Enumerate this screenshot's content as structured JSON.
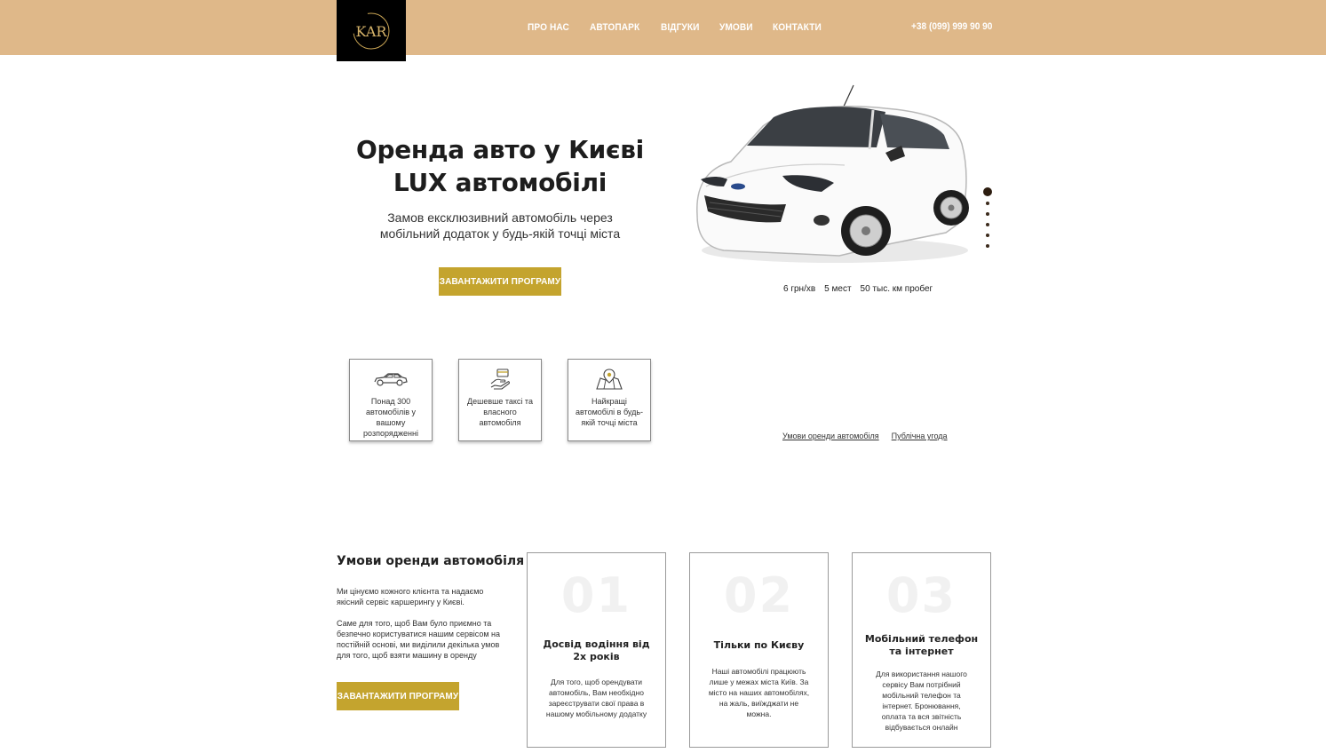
{
  "header": {
    "logo_text": "KAR",
    "nav": [
      "ПРО НАС",
      "АВТОПАРК",
      "ВІДГУКИ",
      "УМОВИ",
      "КОНТАКТИ"
    ],
    "phone": "+38 (099) 999 90 90"
  },
  "hero": {
    "title_line1": "Оренда авто у Києві",
    "title_line2": "LUX автомобілі",
    "subtitle_line1": "Замов ексклюзивний автомобіль через",
    "subtitle_line2": "мобільний додаток у будь-якій точці міста",
    "button": "ЗАВАНТАЖИТИ ПРОГРАМУ",
    "slider_dots": 6,
    "slider_active": 1,
    "specs": [
      "6 грн/хв",
      "5 мест",
      "50 тыс. км пробег"
    ]
  },
  "features": [
    {
      "icon": "car-icon",
      "text": "Понад 300 автомобілів у вашому розпорядженні"
    },
    {
      "icon": "card-hand-icon",
      "text": "Дешевше таксі та власного автомобіля"
    },
    {
      "icon": "map-pin-icon",
      "text": "Найкращі автомобілі в будь-якій точці міста"
    }
  ],
  "links": [
    "Умови оренди автомобіля",
    "Публічна угода"
  ],
  "conditions": {
    "title": "Умови оренди автомобіля",
    "p1": "Ми цінуємо кожного клієнта та надаємо якісний сервіс каршерингу у Києві.",
    "p2": "Саме для того, щоб Вам було приємно та безпечно користуватися нашим сервісом на постійній основі, ми виділили декілька умов для того, щоб взяти машину в оренду",
    "button": "ЗАВАНТАЖИТИ ПРОГРАМУ",
    "cards": [
      {
        "num": "01",
        "title": "Досвід водіння від 2х років",
        "text": "Для того, щоб орендувати автомобіль, Вам необхідно зареєструвати свої права в нашому мобільному додатку"
      },
      {
        "num": "02",
        "title": "Тільки по Києву",
        "text": "Наші автомобілі працюють лише у межах міста Київ. За місто на наших автомобілях, на жаль, виїжджати не можна."
      },
      {
        "num": "03",
        "title": "Мобільний телефон та інтернет",
        "text": "Для використання нашого сервісу Вам потрібний мобільний телефон та інтернет. Бронювання, оплата та вся звітність відбувається онлайн"
      }
    ]
  },
  "colors": {
    "header_bg": "#dfb889",
    "accent": "#c4a42e",
    "logo_bg": "#000000"
  }
}
